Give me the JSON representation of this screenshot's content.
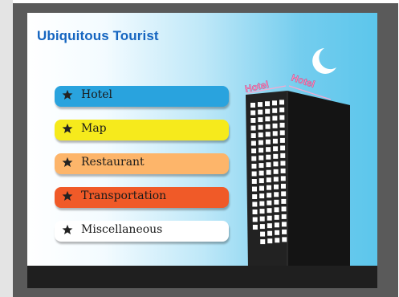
{
  "app": {
    "title": "Ubiquitous Tourist"
  },
  "menu": [
    {
      "label": "Hotel",
      "color": "#29a3de",
      "icon": "star-icon"
    },
    {
      "label": "Map",
      "color": "#f6ea1c",
      "icon": "star-icon"
    },
    {
      "label": "Restaurant",
      "color": "#fdb56a",
      "icon": "star-icon"
    },
    {
      "label": "Transportation",
      "color": "#f05a28",
      "icon": "star-icon"
    },
    {
      "label": "Miscellaneous",
      "color": "#ffffff",
      "icon": "star-icon"
    }
  ],
  "scene": {
    "building_sign": "Hotel Hotel",
    "sign_color": "#f48cc0",
    "moon_icon": "crescent-moon-icon"
  }
}
